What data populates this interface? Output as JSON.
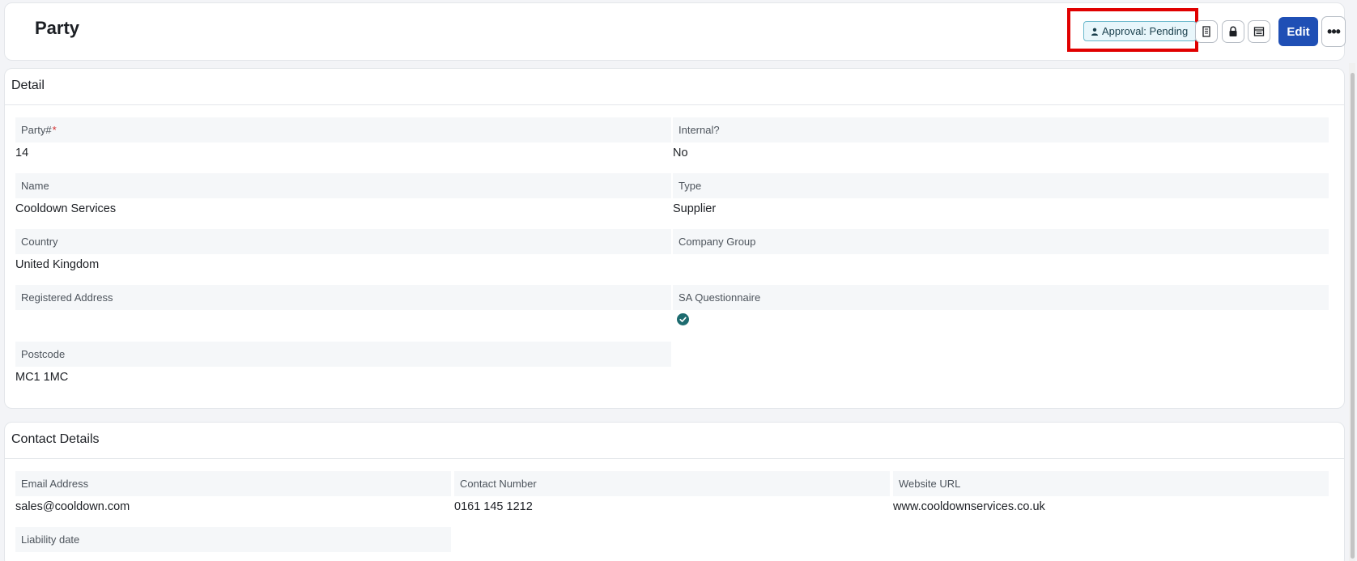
{
  "header": {
    "title": "Party",
    "approval_badge": "Approval: Pending",
    "edit_label": "Edit",
    "more_label": "•••",
    "icons": [
      "document-icon",
      "lock-icon",
      "window-icon"
    ]
  },
  "detail": {
    "title": "Detail",
    "fields": {
      "party_no": {
        "label": "Party#",
        "required": "*",
        "value": "14"
      },
      "internal": {
        "label": "Internal?",
        "value": "No"
      },
      "name": {
        "label": "Name",
        "value": "Cooldown Services"
      },
      "type": {
        "label": "Type",
        "value": "Supplier"
      },
      "country": {
        "label": "Country",
        "value": "United Kingdom"
      },
      "company_group": {
        "label": "Company Group",
        "value": ""
      },
      "registered_address": {
        "label": "Registered Address",
        "value": ""
      },
      "sa_questionnaire": {
        "label": "SA Questionnaire",
        "value_icon": "check-circle-icon"
      },
      "postcode": {
        "label": "Postcode",
        "value": "MC1 1MC"
      }
    }
  },
  "contact": {
    "title": "Contact Details",
    "fields": {
      "email": {
        "label": "Email Address",
        "value": "sales@cooldown.com"
      },
      "phone": {
        "label": "Contact Number",
        "value": "0161 145 1212"
      },
      "website": {
        "label": "Website URL",
        "value": "www.cooldownservices.co.uk"
      },
      "liability": {
        "label": "Liability date",
        "value": ""
      }
    }
  },
  "colors": {
    "primary": "#1f4fb5",
    "highlight": "#e00000",
    "check": "#1d6b6f"
  }
}
